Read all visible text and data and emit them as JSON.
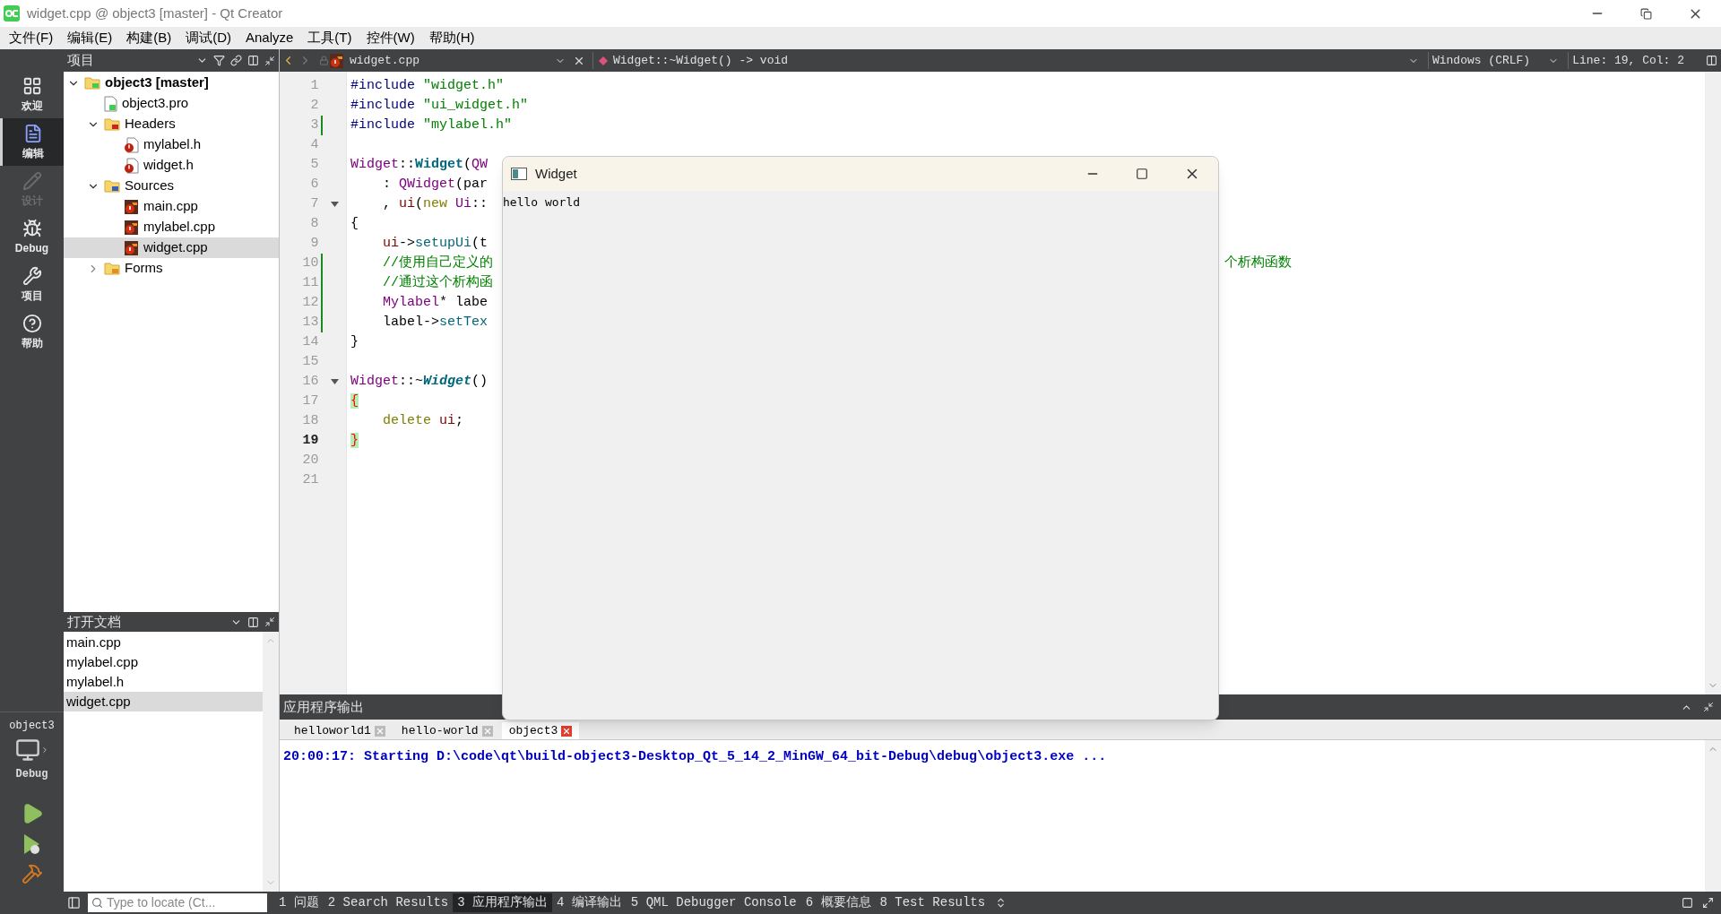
{
  "window": {
    "title": "widget.cpp @ object3 [master] - Qt Creator"
  },
  "menu": [
    "文件(F)",
    "编辑(E)",
    "构建(B)",
    "调试(D)",
    "Analyze",
    "工具(T)",
    "控件(W)",
    "帮助(H)"
  ],
  "modes": [
    {
      "label": "欢迎",
      "kind": "welcome",
      "selected": false,
      "disabled": false
    },
    {
      "label": "编辑",
      "kind": "edit",
      "selected": true,
      "disabled": false
    },
    {
      "label": "设计",
      "kind": "design",
      "selected": false,
      "disabled": true
    },
    {
      "label": "Debug",
      "kind": "debug",
      "selected": false,
      "disabled": false
    },
    {
      "label": "项目",
      "kind": "projects",
      "selected": false,
      "disabled": false
    },
    {
      "label": "帮助",
      "kind": "help",
      "selected": false,
      "disabled": false
    }
  ],
  "target": {
    "project": "object3",
    "config": "Debug"
  },
  "projects_panel": {
    "title": "项目",
    "tree": [
      {
        "label": "object3 [master]",
        "kind": "project",
        "expanded": true,
        "selected": false,
        "children": [
          {
            "label": "object3.pro",
            "kind": "pro",
            "selected": false
          },
          {
            "label": "Headers",
            "kind": "folder_headers",
            "expanded": true,
            "selected": false,
            "children": [
              {
                "label": "mylabel.h",
                "kind": "header",
                "selected": false
              },
              {
                "label": "widget.h",
                "kind": "header",
                "selected": false
              }
            ]
          },
          {
            "label": "Sources",
            "kind": "folder_sources",
            "expanded": true,
            "selected": false,
            "children": [
              {
                "label": "main.cpp",
                "kind": "source",
                "selected": false
              },
              {
                "label": "mylabel.cpp",
                "kind": "source",
                "selected": false
              },
              {
                "label": "widget.cpp",
                "kind": "source",
                "selected": true
              }
            ]
          },
          {
            "label": "Forms",
            "kind": "folder_forms",
            "expanded": false,
            "selected": false
          }
        ]
      }
    ]
  },
  "open_documents": {
    "title": "打开文档",
    "items": [
      {
        "label": "main.cpp",
        "selected": false
      },
      {
        "label": "mylabel.cpp",
        "selected": false
      },
      {
        "label": "mylabel.h",
        "selected": false
      },
      {
        "label": "widget.cpp",
        "selected": true
      }
    ]
  },
  "editor": {
    "file": "widget.cpp",
    "symbol": "Widget::~Widget() -> void",
    "line_ending": "Windows (CRLF)",
    "position": "Line: 19, Col: 2",
    "lines": [
      {
        "number": "1",
        "modified": false,
        "fold": false,
        "current": false,
        "segments": [
          {
            "text": "#include ",
            "kind": "preproc"
          },
          {
            "text": "\"widget.h\"",
            "kind": "string"
          }
        ]
      },
      {
        "number": "2",
        "modified": false,
        "fold": false,
        "current": false,
        "segments": [
          {
            "text": "#include ",
            "kind": "preproc"
          },
          {
            "text": "\"ui_widget.h\"",
            "kind": "string"
          }
        ]
      },
      {
        "number": "3",
        "modified": true,
        "fold": false,
        "current": false,
        "segments": [
          {
            "text": "#include ",
            "kind": "preproc"
          },
          {
            "text": "\"mylabel.h\"",
            "kind": "string"
          }
        ]
      },
      {
        "number": "4",
        "modified": false,
        "fold": false,
        "current": false
      },
      {
        "number": "5",
        "modified": false,
        "fold": false,
        "current": false,
        "segments": [
          {
            "text": "Widget",
            "kind": "type"
          },
          {
            "text": "::",
            "kind": "plain"
          },
          {
            "text": "Widget",
            "kind": "funcdef"
          },
          {
            "text": "(",
            "kind": "plain"
          },
          {
            "text": "QW",
            "kind": "type"
          }
        ]
      },
      {
        "number": "6",
        "modified": false,
        "fold": false,
        "current": false,
        "segments": [
          {
            "text": "    : ",
            "kind": "plain"
          },
          {
            "text": "QWidget",
            "kind": "type"
          },
          {
            "text": "(par",
            "kind": "plain"
          }
        ]
      },
      {
        "number": "7",
        "modified": false,
        "fold": true,
        "current": false,
        "segments": [
          {
            "text": "    , ",
            "kind": "plain"
          },
          {
            "text": "ui",
            "kind": "field"
          },
          {
            "text": "(",
            "kind": "plain"
          },
          {
            "text": "new",
            "kind": "keyword"
          },
          {
            "text": " Ui",
            "kind": "type"
          },
          {
            "text": "::",
            "kind": "plain"
          }
        ]
      },
      {
        "number": "8",
        "modified": false,
        "fold": false,
        "current": false,
        "segments": [
          {
            "text": "{",
            "kind": "plain"
          }
        ]
      },
      {
        "number": "9",
        "modified": false,
        "fold": false,
        "current": false,
        "segments": [
          {
            "text": "    ui",
            "kind": "field"
          },
          {
            "text": "->",
            "kind": "plain"
          },
          {
            "text": "setupUi",
            "kind": "func"
          },
          {
            "text": "(t",
            "kind": "plain"
          }
        ]
      },
      {
        "number": "10",
        "modified": true,
        "fold": false,
        "current": false,
        "segments": [
          {
            "text": "    //使用自己定义的",
            "kind": "comment"
          }
        ],
        "after_window": {
          "text": "个析构函数",
          "kind": "comment"
        }
      },
      {
        "number": "11",
        "modified": true,
        "fold": false,
        "current": false,
        "segments": [
          {
            "text": "    //通过这个析构函",
            "kind": "comment"
          }
        ]
      },
      {
        "number": "12",
        "modified": true,
        "fold": false,
        "current": false,
        "segments": [
          {
            "text": "    Mylabel",
            "kind": "type"
          },
          {
            "text": "* labe",
            "kind": "plain"
          }
        ]
      },
      {
        "number": "13",
        "modified": true,
        "fold": false,
        "current": false,
        "segments": [
          {
            "text": "    label->",
            "kind": "plain"
          },
          {
            "text": "setTex",
            "kind": "func"
          }
        ]
      },
      {
        "number": "14",
        "modified": false,
        "fold": false,
        "current": false,
        "segments": [
          {
            "text": "}",
            "kind": "plain"
          }
        ]
      },
      {
        "number": "15",
        "modified": false,
        "fold": false,
        "current": false
      },
      {
        "number": "16",
        "modified": false,
        "fold": true,
        "current": false,
        "segments": [
          {
            "text": "Widget",
            "kind": "type"
          },
          {
            "text": "::~",
            "kind": "plain"
          },
          {
            "text": "Widget",
            "kind": "funcdef_italic"
          },
          {
            "text": "()",
            "kind": "plain"
          }
        ]
      },
      {
        "number": "17",
        "modified": false,
        "fold": false,
        "current": false,
        "segments": [
          {
            "text": "{",
            "kind": "brace_match"
          }
        ]
      },
      {
        "number": "18",
        "modified": false,
        "fold": false,
        "current": false,
        "segments": [
          {
            "text": "    delete",
            "kind": "keyword"
          },
          {
            "text": " ui",
            "kind": "field"
          },
          {
            "text": ";",
            "kind": "plain"
          }
        ]
      },
      {
        "number": "19",
        "modified": false,
        "fold": false,
        "current": true,
        "segments": [
          {
            "text": "}",
            "kind": "brace_match"
          }
        ]
      },
      {
        "number": "20",
        "modified": false,
        "fold": false,
        "current": false
      },
      {
        "number": "21",
        "modified": false,
        "fold": false,
        "current": false
      }
    ]
  },
  "app_window": {
    "title": "Widget",
    "label": "hello world"
  },
  "output": {
    "title": "应用程序输出",
    "tabs": [
      {
        "label": "helloworld1",
        "selected": false
      },
      {
        "label": "hello-world",
        "selected": false
      },
      {
        "label": "object3",
        "selected": true
      }
    ],
    "text": "20:00:17: Starting D:\\code\\qt\\build-object3-Desktop_Qt_5_14_2_MinGW_64_bit-Debug\\debug\\object3.exe ..."
  },
  "status_bar": {
    "locator_placeholder": "Type to locate (Ct...",
    "panes": [
      {
        "label": "1 问题",
        "selected": false
      },
      {
        "label": "2 Search Results",
        "selected": false
      },
      {
        "label": "3 应用程序输出",
        "selected": true
      },
      {
        "label": "4 编译输出",
        "selected": false
      },
      {
        "label": "5 QML Debugger Console",
        "selected": false
      },
      {
        "label": "6 概要信息",
        "selected": false
      },
      {
        "label": "8 Test Results",
        "selected": false
      }
    ]
  }
}
